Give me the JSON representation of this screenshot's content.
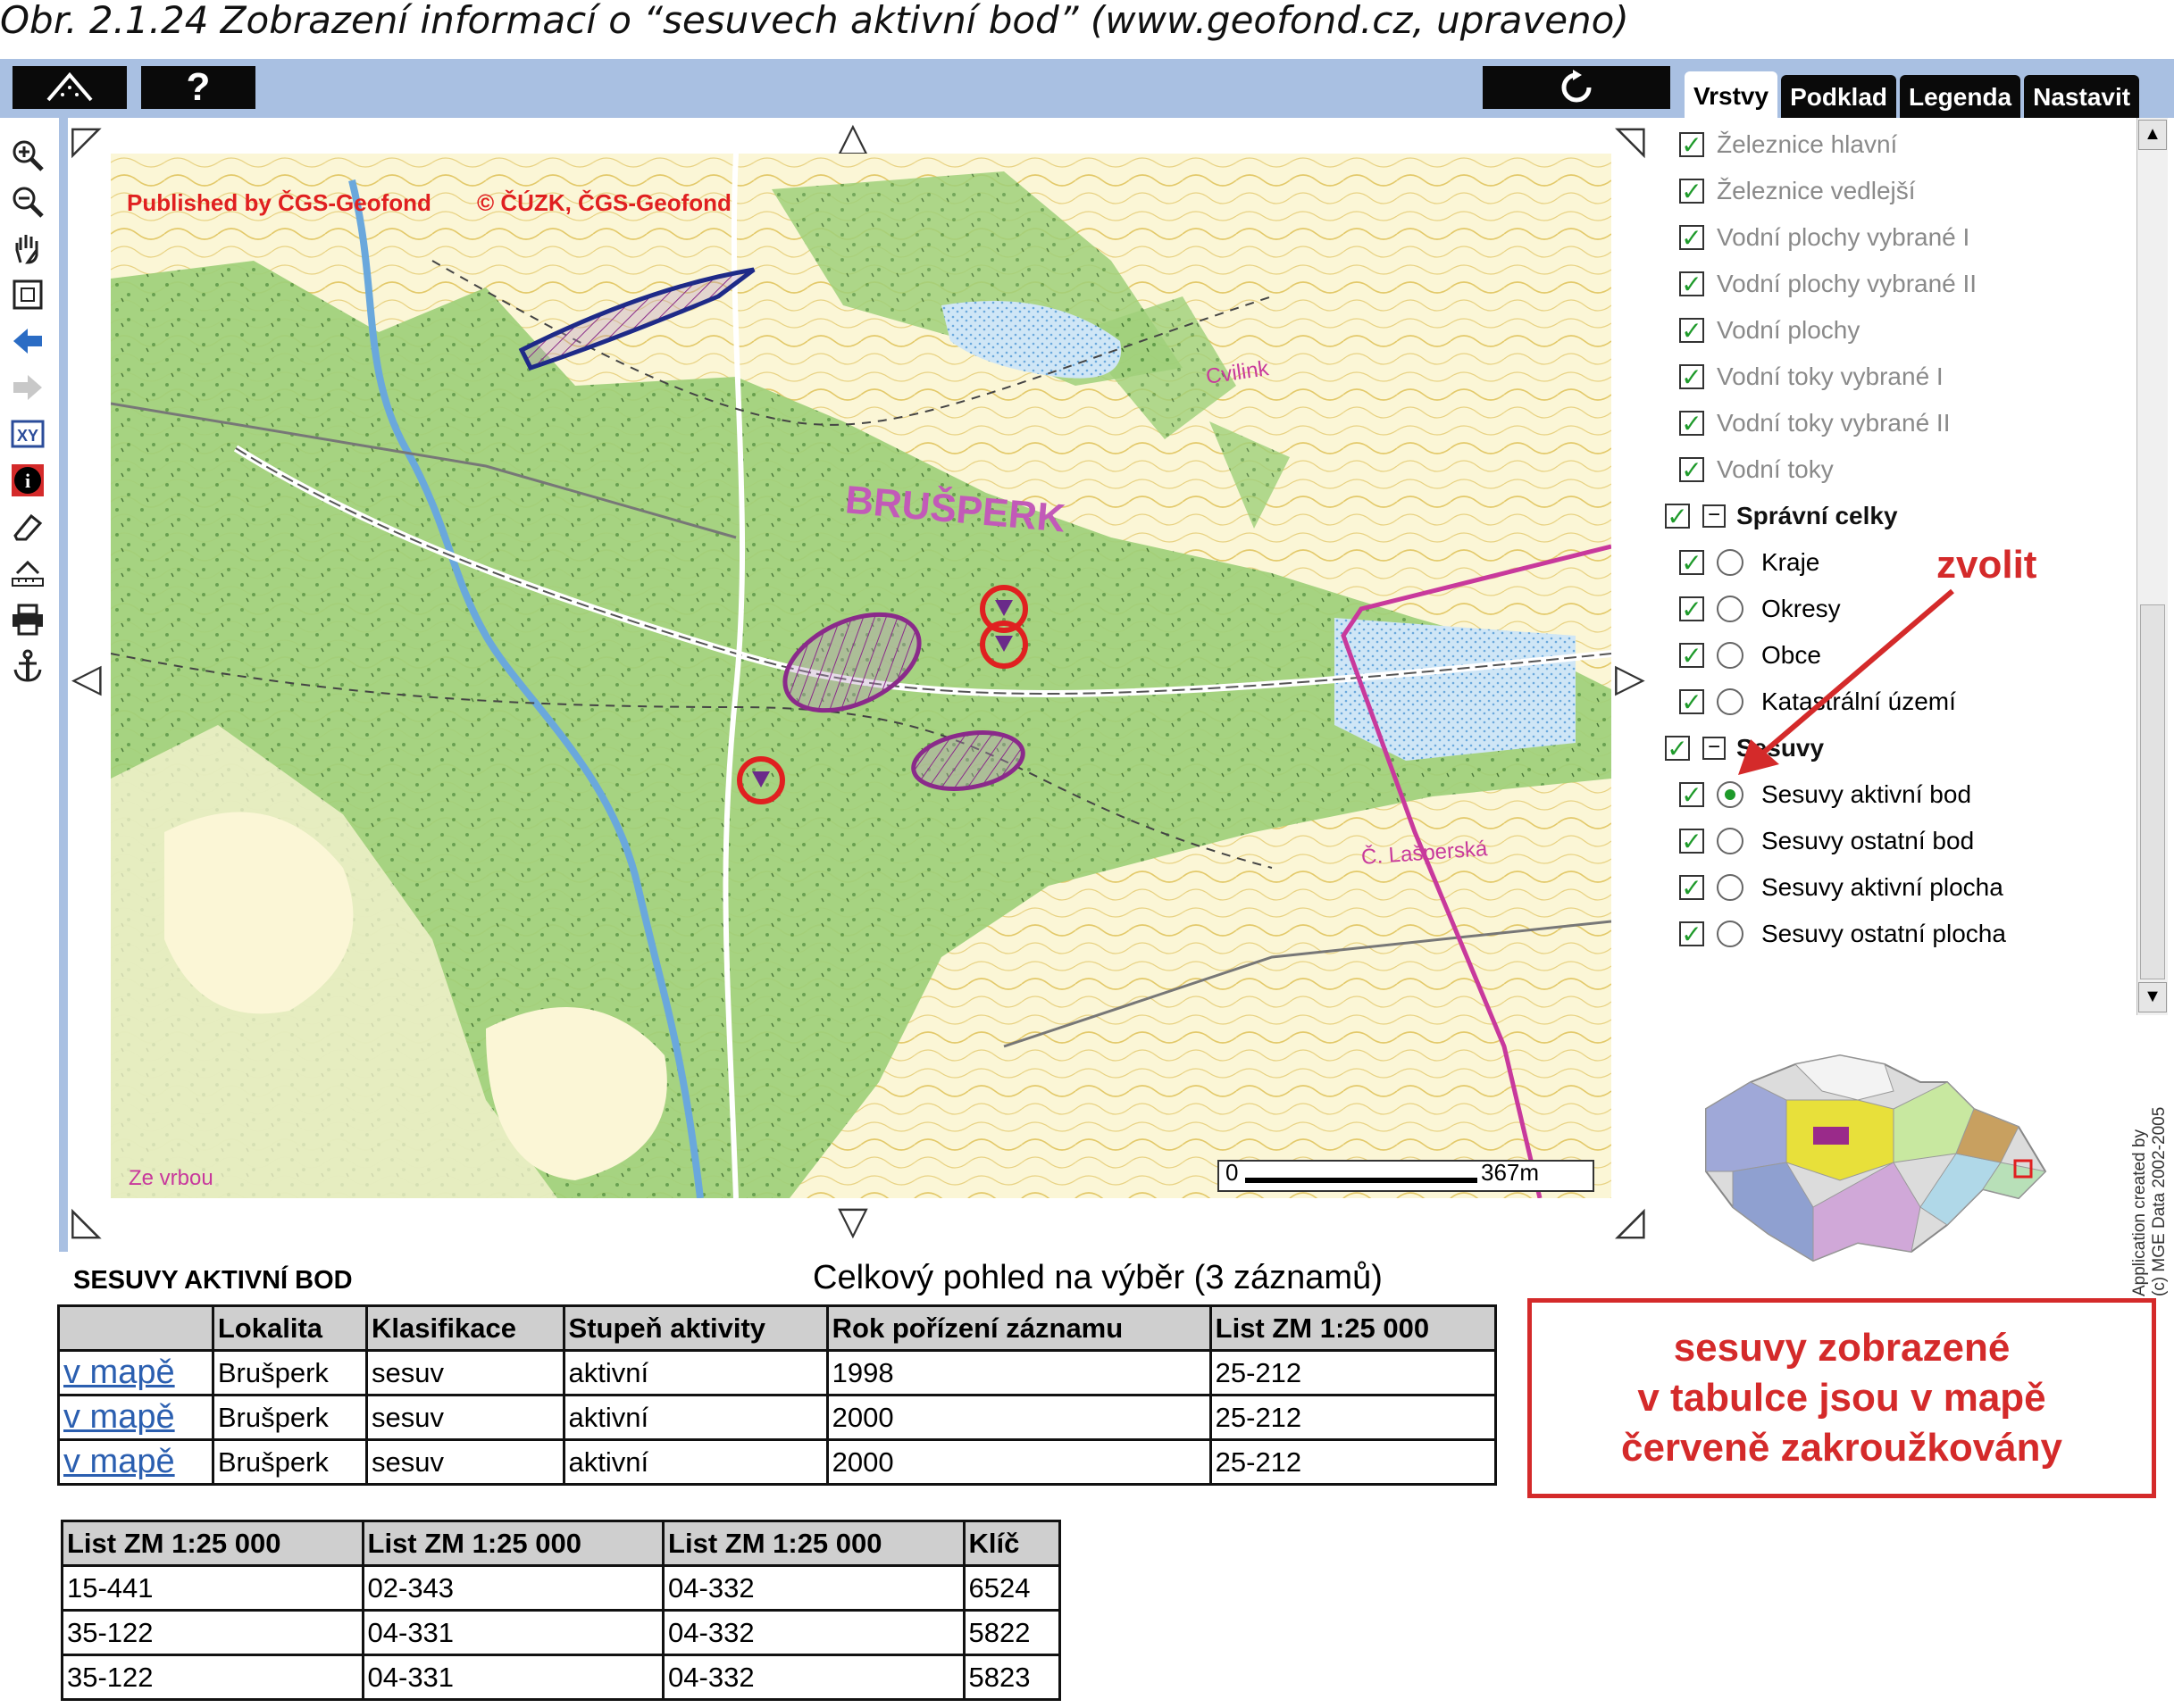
{
  "caption": "Obr. 2.1.24 Zobrazení informací o “sesuvech aktivní bod” (www.geofond.cz, upraveno)",
  "colors": {
    "frame_bg": "#a9c0e2",
    "annotation_red": "#d42a2a",
    "check_green": "#1e9a2a",
    "map_green": "#9fd07a",
    "map_paper": "#fbf6d6",
    "landslide_purple": "#8a2a8a",
    "boundary_magenta": "#c8399c"
  },
  "toolbar": {
    "measure_icon": "measure-icon",
    "help_label": "?",
    "refresh_icon": "refresh-icon"
  },
  "tabs": [
    {
      "label": "Vrstvy",
      "active": true
    },
    {
      "label": "Podklad",
      "active": false
    },
    {
      "label": "Legenda",
      "active": false
    },
    {
      "label": "Nastavit",
      "active": false
    }
  ],
  "tools": [
    "zoom-in-icon",
    "zoom-out-icon",
    "pan-hand-icon",
    "full-extent-icon",
    "back-arrow-icon",
    "forward-arrow-icon",
    "xy-coordinates-icon",
    "info-icon",
    "eraser-icon",
    "measure-icon",
    "print-icon",
    "anchor-icon"
  ],
  "map": {
    "publisher": "Published by ČGS-Geofond",
    "copyright": "© ČÚZK, ČGS-Geofond",
    "town_label": "BRUŠPERK",
    "scale_left": "0",
    "scale_right": "367m",
    "place_labels": [
      "Cvilink",
      "Č. Lašperská",
      "Ze vrbou"
    ]
  },
  "layers": [
    {
      "label": "Železnice hlavní",
      "checked": true,
      "type": "item-grey"
    },
    {
      "label": "Železnice vedlejší",
      "checked": true,
      "type": "item-grey"
    },
    {
      "label": "Vodní plochy vybrané I",
      "checked": true,
      "type": "item-grey"
    },
    {
      "label": "Vodní plochy vybrané II",
      "checked": true,
      "type": "item-grey"
    },
    {
      "label": "Vodní plochy",
      "checked": true,
      "type": "item-grey"
    },
    {
      "label": "Vodní toky vybrané I",
      "checked": true,
      "type": "item-grey"
    },
    {
      "label": "Vodní toky vybrané II",
      "checked": true,
      "type": "item-grey"
    },
    {
      "label": "Vodní toky",
      "checked": true,
      "type": "item-grey"
    },
    {
      "label": "Správní celky",
      "checked": true,
      "type": "group"
    },
    {
      "label": "Kraje",
      "checked": true,
      "type": "radio",
      "selected": false
    },
    {
      "label": "Okresy",
      "checked": true,
      "type": "radio",
      "selected": false
    },
    {
      "label": "Obce",
      "checked": true,
      "type": "radio",
      "selected": false
    },
    {
      "label": "Katastrální území",
      "checked": true,
      "type": "radio",
      "selected": false
    },
    {
      "label": "Sesuvy",
      "checked": true,
      "type": "group"
    },
    {
      "label": "Sesuvy aktivní bod",
      "checked": true,
      "type": "radio",
      "selected": true
    },
    {
      "label": "Sesuvy ostatní bod",
      "checked": true,
      "type": "radio",
      "selected": false
    },
    {
      "label": "Sesuvy aktivní plocha",
      "checked": true,
      "type": "radio",
      "selected": false
    },
    {
      "label": "Sesuvy ostatní plocha",
      "checked": true,
      "type": "radio",
      "selected": false
    }
  ],
  "credit": [
    "Application created by",
    "(c) MGE Data 2002-2005"
  ],
  "annotation": {
    "zvolit": "zvolit"
  },
  "results": {
    "title": "SESUVY AKTIVNÍ BOD",
    "summary": "Celkový pohled na výběr (3 záznamů)",
    "table1": {
      "headers": [
        "",
        "Lokalita",
        "Klasifikace",
        "Stupeň aktivity",
        "Rok pořízení záznamu",
        "List ZM 1:25 000"
      ],
      "rows": [
        [
          "v mapě",
          "Brušperk",
          "sesuv",
          "aktivní",
          "1998",
          "25-212"
        ],
        [
          "v mapě",
          "Brušperk",
          "sesuv",
          "aktivní",
          "2000",
          "25-212"
        ],
        [
          "v mapě",
          "Brušperk",
          "sesuv",
          "aktivní",
          "2000",
          "25-212"
        ]
      ]
    },
    "table2": {
      "headers": [
        "List ZM 1:25 000",
        "List ZM 1:25 000",
        "List ZM 1:25 000",
        "Klíč"
      ],
      "rows": [
        [
          "15-441",
          "02-343",
          "04-332",
          "6524"
        ],
        [
          "35-122",
          "04-331",
          "04-332",
          "5822"
        ],
        [
          "35-122",
          "04-331",
          "04-332",
          "5823"
        ]
      ]
    }
  },
  "note": [
    "sesuvy zobrazené",
    "v tabulce jsou v mapě",
    "červeně zakroužkovány"
  ]
}
